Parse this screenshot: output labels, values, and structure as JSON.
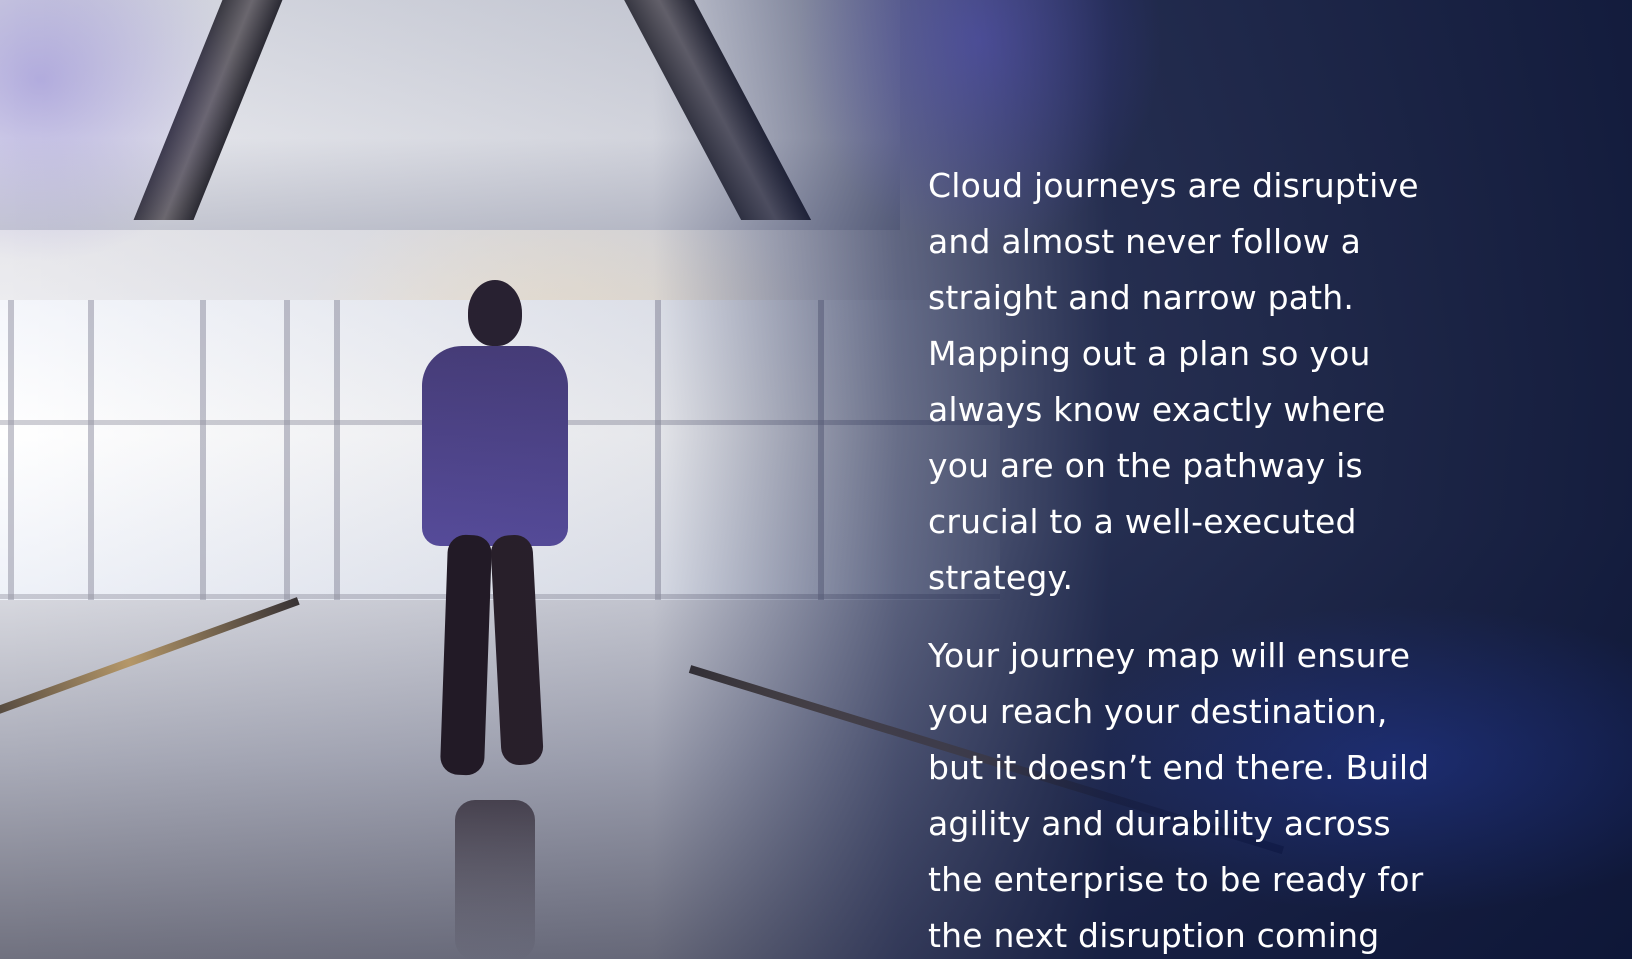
{
  "copy": {
    "paragraph_1": "Cloud journeys are disruptive\nand almost never follow a\nstraight and narrow path.\nMapping out a plan so you\nalways know exactly where\nyou are on the pathway is\ncrucial to a well-executed\nstrategy.",
    "paragraph_2": "Your journey map will ensure\nyou reach your destination,\nbut it doesn’t end there. Build\nagility and durability across\nthe enterprise to be ready for\nthe next disruption coming"
  },
  "colors": {
    "overlay_navy": "#0b1434",
    "text": "#ffffff"
  }
}
